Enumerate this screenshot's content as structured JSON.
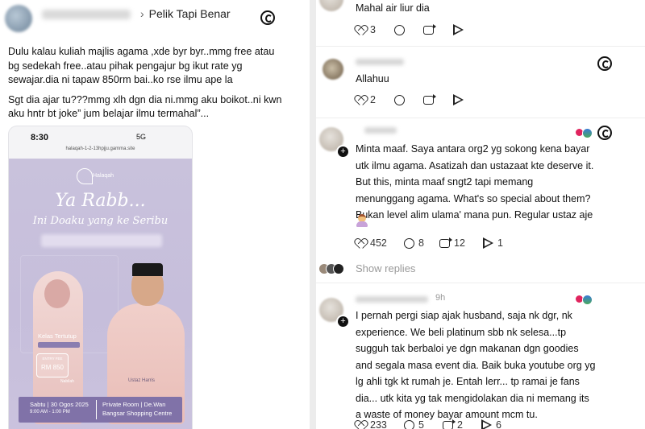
{
  "left_post": {
    "breadcrumb": "Pelik Tapi Benar",
    "chevron": "›",
    "text_lines": [
      "Dulu kalau kuliah majlis agama ,xde byr byr..mmg free atau",
      "bg sedekah free..atau pihak pengajur bg ikut rate yg",
      "sewajar.dia ni tapaw 850rm bai..ko rse ilmu ape la",
      "Sgt dia ajar tu???mmg xlh dgn dia ni.mmg aku boikot..ni kwn",
      "aku hntr bt joke” jum belajar ilmu termahal”..."
    ],
    "phone": {
      "time": "8:30",
      "status": "5G",
      "url": "halaqah-1-2-13hpjju.gamma.site",
      "poster_logo": "Halaqah",
      "poster_title": "Ya Rabb...",
      "poster_subtitle": "Ini Doaku yang ke Seribu",
      "kelas": "Kelas Tertutup",
      "entry_label": "ENTRY FEE",
      "entry_price": "RM 850",
      "name_left": "Nabilah",
      "name_right": "Ustaz Harris",
      "footer_date": "Sabtu | 30 Ogos 2025",
      "footer_time": "9:00 AM - 1:00 PM",
      "footer_place1": "Private Room | De.Wan",
      "footer_place2": "Bangsar Shopping Centre"
    }
  },
  "comments": [
    {
      "text_lines": [
        "Mahal air liur dia"
      ],
      "likes": "3",
      "replies": "",
      "reposts": "",
      "shares": ""
    },
    {
      "text_lines": [
        "Allahuu"
      ],
      "likes": "2",
      "replies": "",
      "reposts": "",
      "shares": ""
    },
    {
      "text_lines": [
        "Minta maaf. Saya antara org2 yg sokong kena bayar",
        "utk ilmu agama. Asatizah dan ustazaat kte deserve it.",
        "But this, minta maaf sngt2 tapi memang",
        "menunggang agama. What's so special about them?",
        "Bukan level alim ulama' mana pun. Regular ustaz aje"
      ],
      "likes": "452",
      "replies": "8",
      "reposts": "12",
      "shares": "1"
    },
    {
      "text_lines": [
        "I pernah pergi siap ajak husband, saja nk dgr, nk",
        "experience. We beli platinum sbb nk selesa...tp",
        "sugguh tak berbaloi ye dgn makanan dgn goodies",
        "and segala masa event dia. Baik buka youtube org yg",
        "lg ahli tgk kt rumah je. Entah lerr... tp ramai je fans",
        "dia... utk kita yg tak mengidolakan dia ni memang its",
        "a waste of money bayar amount mcm tu."
      ],
      "likes": "233",
      "replies": "5",
      "reposts": "2",
      "shares": "6"
    }
  ],
  "show_replies": "Show replies",
  "timestamp_partial": "9h",
  "colors": {
    "accent_heart": "#e0245e",
    "divider": "#ececec",
    "muted": "#999999"
  }
}
